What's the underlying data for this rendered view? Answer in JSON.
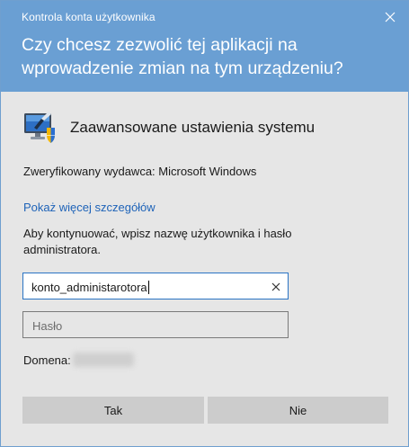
{
  "window": {
    "title": "Kontrola konta użytkownika"
  },
  "header": {
    "question": "Czy chcesz zezwolić tej aplikacji na wprowadzenie zmian na tym urządzeniu?"
  },
  "app": {
    "name": "Zaawansowane ustawienia systemu",
    "icon": "system-settings-monitor-icon"
  },
  "publisher": {
    "text": "Zweryfikowany wydawca: Microsoft Windows"
  },
  "details_link": "Pokaż więcej szczegółów",
  "instructions": "Aby kontynuować, wpisz nazwę użytkownika i hasło administratora.",
  "form": {
    "username_value": "konto_administarotora",
    "password_placeholder": "Hasło",
    "domain_label": "Domena:"
  },
  "buttons": {
    "yes": "Tak",
    "no": "Nie"
  },
  "colors": {
    "header_bg": "#6a9fd3",
    "body_bg": "#e6e6e6",
    "link": "#1e63b8",
    "input_focus_border": "#2b74c4",
    "button_bg": "#cccccc"
  }
}
